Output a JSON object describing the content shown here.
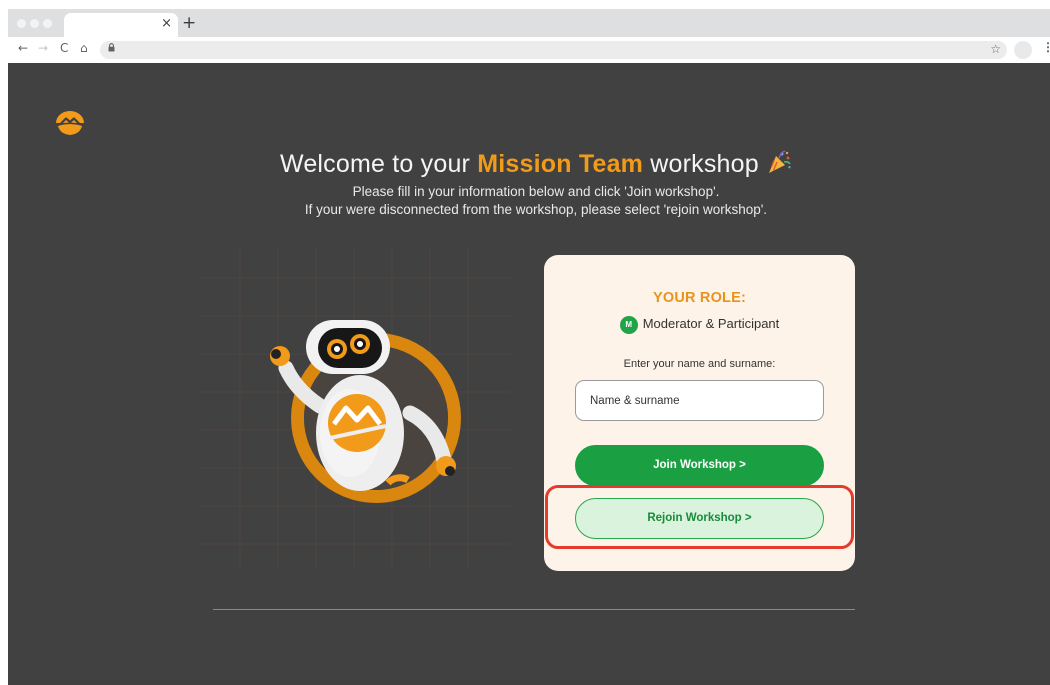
{
  "browser": {
    "tab_close": "×",
    "new_tab": "+",
    "nav": {
      "back": "←",
      "forward": "→",
      "reload": "C",
      "home": "⌂"
    },
    "star": "☆",
    "menu": "⋮",
    "icons": [
      "close-icon",
      "plus-icon",
      "back-arrow-icon",
      "forward-arrow-icon",
      "reload-icon",
      "home-icon",
      "lock-icon",
      "star-icon",
      "profile-avatar",
      "kebab-menu-icon"
    ]
  },
  "page": {
    "heading": {
      "prefix": "Welcome to your ",
      "accent": "Mission Team",
      "suffix": " workshop"
    },
    "subtitle_line1": "Please fill in your information below and click 'Join workshop'.",
    "subtitle_line2": "If your were disconnected from the workshop, please select 'rejoin workshop'."
  },
  "form": {
    "role_title": "YOUR ROLE:",
    "role_badge": "M",
    "role_name": "Moderator & Participant",
    "name_label": "Enter your name and surname:",
    "name_placeholder": "Name & surname",
    "name_value": "",
    "join_button": "Join Workshop >",
    "rejoin_button": "Rejoin Workshop >"
  },
  "colors": {
    "accent": "#f29a1a",
    "page_bg": "#414141",
    "card_bg": "#fdf3e8",
    "join_green": "#1aa043",
    "rejoin_bg": "#d9f3dc",
    "highlight_red": "#e53b2c"
  }
}
